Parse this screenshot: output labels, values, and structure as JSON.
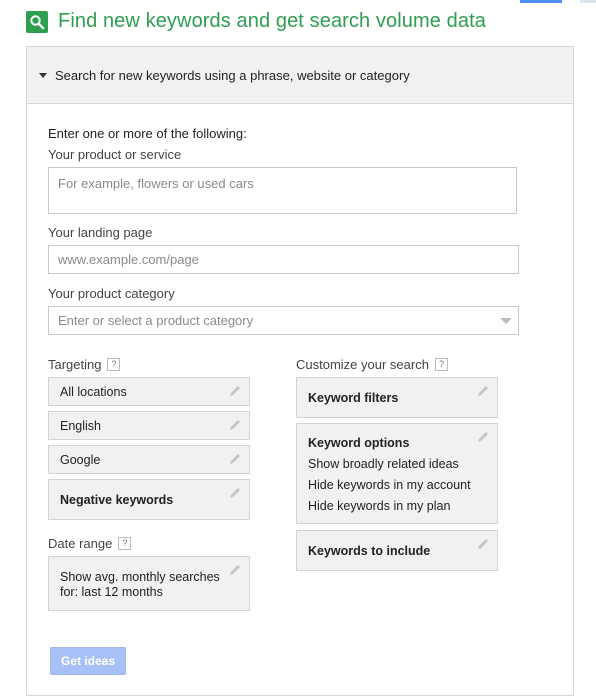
{
  "title": "Find new keywords and get search volume data",
  "panel": {
    "header": "Search for new keywords using a phrase, website or category",
    "instructions": "Enter one or more of the following:"
  },
  "product": {
    "label": "Your product or service",
    "placeholder": "For example, flowers or used cars"
  },
  "landing": {
    "label": "Your landing page",
    "placeholder": "www.example.com/page"
  },
  "category": {
    "label": "Your product category",
    "placeholder": "Enter or select a product category"
  },
  "targeting": {
    "label": "Targeting",
    "help": "?",
    "locations": "All locations",
    "language": "English",
    "network": "Google",
    "negative": "Negative keywords"
  },
  "date_range": {
    "label": "Date range",
    "help": "?",
    "line1": "Show avg. monthly searches",
    "line2": "for: last 12 months"
  },
  "customize": {
    "label": "Customize your search",
    "help": "?",
    "filters": "Keyword filters",
    "options_title": "Keyword options",
    "options": [
      "Show broadly related ideas",
      "Hide keywords in my account",
      "Hide keywords in my plan"
    ],
    "include": "Keywords to include"
  },
  "button": {
    "get_ideas": "Get ideas"
  },
  "colors": {
    "accent_green": "#2e9e51",
    "button_blue": "#a7c1f7"
  },
  "icons": {
    "title": "search-icon",
    "edit": "pencil-icon",
    "expand": "caret-down-icon"
  }
}
